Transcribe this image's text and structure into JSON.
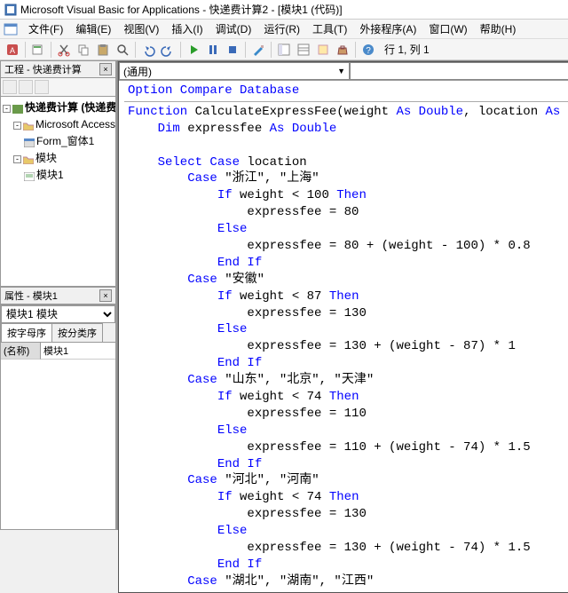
{
  "title": "Microsoft Visual Basic for Applications - 快递费计算2 - [模块1 (代码)]",
  "menu": {
    "file": "文件(F)",
    "edit": "编辑(E)",
    "view": "视图(V)",
    "insert": "插入(I)",
    "debug": "调试(D)",
    "run": "运行(R)",
    "tools": "工具(T)",
    "addins": "外接程序(A)",
    "window": "窗口(W)",
    "help": "帮助(H)"
  },
  "status_pos": "行 1, 列 1",
  "proj_panel_title": "工程 - 快递费计算",
  "tree": {
    "root": "快递费计算 (快递费计…",
    "cls_folder": "Microsoft Access 类",
    "form": "Form_窗体1",
    "mod_folder": "模块",
    "mod1": "模块1"
  },
  "prop_panel_title": "属性 - 模块1",
  "prop_combo": "模块1 模块",
  "prop_tabs": {
    "alpha": "按字母序",
    "cat": "按分类序"
  },
  "prop_row": {
    "key": "(名称)",
    "val": "模块1"
  },
  "code_combo_left": "(通用)",
  "code": {
    "l1": "Option Compare Database",
    "l2a": "Function ",
    "l2b": "CalculateExpressFee(weight ",
    "l2c": "As Double",
    "l2d": ", location ",
    "l2e": "As S",
    "l3a": "    Dim ",
    "l3b": "expressfee ",
    "l3c": "As Double",
    "l4a": "    Select Case ",
    "l4b": "location",
    "l5a": "        Case ",
    "l5b": "\"浙江\", \"上海\"",
    "l6a": "            If ",
    "l6b": "weight < 100 ",
    "l6c": "Then",
    "l7": "                expressfee = 80",
    "l8": "            Else",
    "l9": "                expressfee = 80 + (weight - 100) * 0.8",
    "l10": "            End If",
    "l11a": "        Case ",
    "l11b": "\"安徽\"",
    "l12a": "            If ",
    "l12b": "weight < 87 ",
    "l12c": "Then",
    "l13": "                expressfee = 130",
    "l14": "            Else",
    "l15": "                expressfee = 130 + (weight - 87) * 1",
    "l16": "            End If",
    "l17a": "        Case ",
    "l17b": "\"山东\", \"北京\", \"天津\"",
    "l18a": "            If ",
    "l18b": "weight < 74 ",
    "l18c": "Then",
    "l19": "                expressfee = 110",
    "l20": "            Else",
    "l21": "                expressfee = 110 + (weight - 74) * 1.5",
    "l22": "            End If",
    "l23a": "        Case ",
    "l23b": "\"河北\", \"河南\"",
    "l24a": "            If ",
    "l24b": "weight < 74 ",
    "l24c": "Then",
    "l25": "                expressfee = 130",
    "l26": "            Else",
    "l27": "                expressfee = 130 + (weight - 74) * 1.5",
    "l28": "            End If",
    "l29a": "        Case ",
    "l29b": "\"湖北\", \"湖南\", \"江西\""
  }
}
